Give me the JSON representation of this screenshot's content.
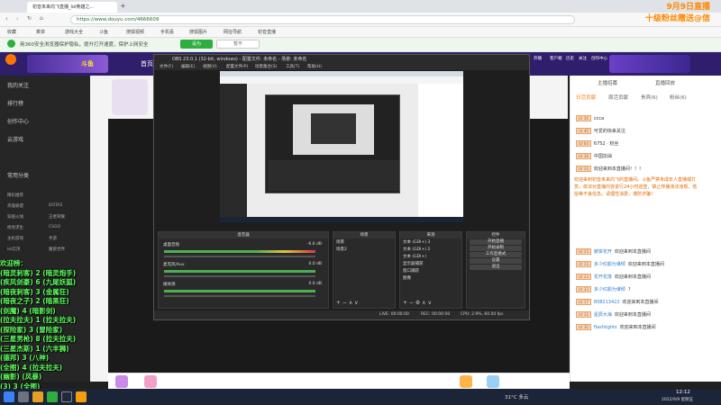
{
  "browser": {
    "tab_active": "初音未来向飞直播_lol英雄之...",
    "tab_new": "+",
    "url": "https://www.douyu.com/4666609",
    "bookmarks": [
      "收藏",
      "菜单",
      "游戏大全",
      "斗鱼",
      "搜狐视频",
      "手机看",
      "搜狐图片",
      "网址导航",
      "初音直播"
    ],
    "security_notice": "用360安全浏览器保护隐私，提升打开速度，保护上网安全",
    "security_btn": "设为",
    "security_btn2": "暂不"
  },
  "promo": {
    "line1": "9月9日直播",
    "line2": "十级粉丝赠送@信"
  },
  "header": {
    "logo": "斗鱼",
    "nav_home": "首页",
    "right_icons": [
      "开播",
      "客户端",
      "历史",
      "关注",
      "创作中心"
    ]
  },
  "sidenav": {
    "items": [
      "我的关注",
      "排行榜",
      "创作中心",
      "云游戏",
      "常用分类"
    ],
    "footer": "精彩推荐",
    "categories": [
      "英雄联盟",
      "DOTA2",
      "穿越火线",
      "王者荣耀",
      "绝地求生",
      "CSGO",
      "主机游戏",
      "手游",
      "lol云顶",
      "魔兽世界"
    ]
  },
  "obs": {
    "title": "OBS 23.0.1 (32-bit, windows) - 配置文件: 未命名 - 场景: 未命名",
    "menu": [
      "文件(F)",
      "编辑(E)",
      "视图(V)",
      "配置文件(P)",
      "场景集合(S)",
      "工具(T)",
      "帮助(H)"
    ],
    "docks": {
      "mixer": "混音器",
      "scenes": "场景",
      "sources": "来源",
      "controls": "控件"
    },
    "mixer_tracks": [
      "桌面音频",
      "麦克风/Aux",
      "媒体源"
    ],
    "mixer_db": [
      "-6.6 dB",
      "0.0 dB",
      "0.0 dB"
    ],
    "scene_items": [
      "场景",
      "场景2"
    ],
    "source_items": [
      "文本 (GDI+) 3",
      "文本 (GDI+) 2",
      "文本 (GDI+)",
      "显示器捕获",
      "窗口捕获",
      "图像"
    ],
    "control_buttons": [
      "开始直播",
      "开始录制",
      "工作室模式",
      "设置",
      "退出"
    ],
    "status": {
      "live": "LIVE: 00:00:00",
      "rec": "REC: 00:00:00",
      "cpu": "CPU: 2.9%, 60.00 fps"
    }
  },
  "chat": {
    "head_tabs": [
      "主播招募",
      "直播回放"
    ],
    "tabs": [
      "日活贡献",
      "周活贡献",
      "贵宾(6)",
      "粉丝(6)"
    ],
    "messages_top": [
      {
        "lvl": "LV 36",
        "text": "ccca"
      },
      {
        "lvl": "LV 40",
        "text": "可爱的快来关注"
      },
      {
        "lvl": "LV 64",
        "text": "6752 · 粉丝"
      },
      {
        "lvl": "LV 38",
        "text": "中国加油"
      },
      {
        "lvl": "LV 33",
        "text": "欢迎来到本直播间！！！"
      }
    ],
    "notice": "欢迎来到初音未来向飞的直播间。斗鱼严禁未成年人直播或打赏。依法对直播内容进行24小时巡查，禁止传播违法违规、低俗等不良信息。请理性消费，谨防诈骗！",
    "messages_bottom": [
      {
        "lvl": "LV 15",
        "user": "彼岸花开",
        "text": "欢迎来到本直播间"
      },
      {
        "lvl": "LV 33",
        "user": "多少红颜为谁倾",
        "text": "欢迎来到本直播间"
      },
      {
        "lvl": "LV 23",
        "user": "花开花落",
        "text": "欢迎来到本直播间"
      },
      {
        "lvl": "LV 33",
        "user": "多少红颜为谁倾",
        "text": "?"
      },
      {
        "lvl": "LV 17",
        "user": "808213422",
        "text": "欢迎来到本直播间"
      },
      {
        "lvl": "LV 33",
        "user": "星辰大海",
        "text": "欢迎来到本直播间"
      },
      {
        "lvl": "LV 30",
        "user": "flashlights",
        "text": "欢迎来到本直播间"
      }
    ]
  },
  "overlay_text": "欢迎榜：\n(暗灵刺客) 2 (暗灵炮手)\n(疾风剑豪) 6 (九尾妖狐)\n(暗夜刺客) 3 (金属狂)\n(暗夜之子) 2 (暗黑狂)\n(剑魔) 4 (暗影剑)\n(拉夫拉夫) 1 (拉夫拉夫)\n(探险家) 3 (冒险家)\n(三星男枪) 8 (拉夫拉夫)\n(三星杰斯) 1 (六丰狮)\n(德邦) 3 (八神)\n(全图) 4 (拉夫拉夫)\n(幽影) (风暴)\n(3) 3 (全图)",
  "taskbar": {
    "weather": "31°C 多云",
    "time": "12:12",
    "date": "2022/9/9 星期五"
  },
  "colors": {
    "accent": "#ff7700",
    "overlay_green": "#5cff5c",
    "promo_orange": "#ff8800",
    "douyu_purple": "#2f1e6b"
  }
}
